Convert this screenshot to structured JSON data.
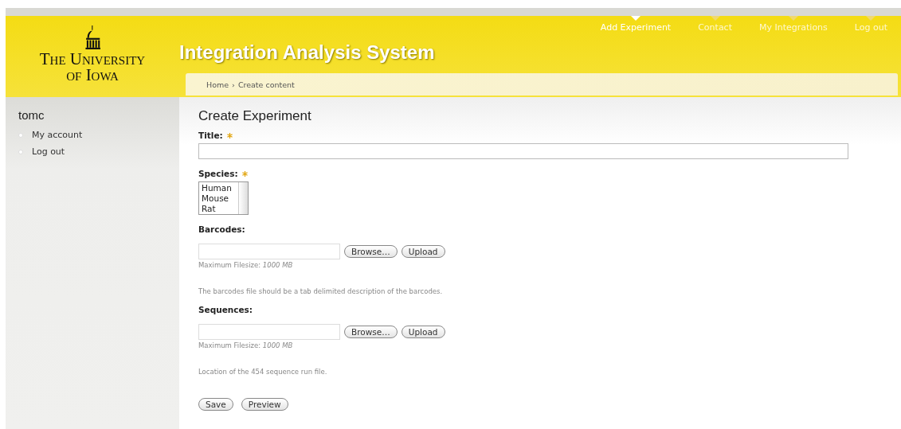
{
  "logo": {
    "line1": "The University",
    "line2": "of Iowa"
  },
  "site_title": "Integration Analysis System",
  "nav": [
    {
      "label": "Add Experiment",
      "selected": true
    },
    {
      "label": "Contact",
      "selected": false
    },
    {
      "label": "My Integrations",
      "selected": false
    },
    {
      "label": "Log out",
      "selected": false
    }
  ],
  "breadcrumb": [
    "Home",
    "›",
    "Create content"
  ],
  "sidebar": {
    "user": "tomc",
    "items": [
      "My account",
      "Log out"
    ]
  },
  "page_title": "Create Experiment",
  "fields": [
    {
      "kind": "text",
      "label": "Title:",
      "required": true
    },
    {
      "kind": "list",
      "label": "Species:",
      "required": true,
      "options": [
        "Human",
        "Mouse",
        "Rat"
      ]
    },
    {
      "kind": "file",
      "label": "Barcodes:",
      "required": false,
      "buttons": [
        "Browse…",
        "Upload"
      ],
      "size_note": "Maximum Filesize: *1000 MB*",
      "description": "The barcodes file should be a tab delimited description of the barcodes."
    },
    {
      "kind": "file",
      "label": "Sequences:",
      "required": false,
      "buttons": [
        "Browse…",
        "Upload"
      ],
      "size_note": "Maximum Filesize: *1000 MB*",
      "description": "Location of the 454 sequence run file."
    }
  ],
  "actions": [
    "Save",
    "Preview"
  ]
}
